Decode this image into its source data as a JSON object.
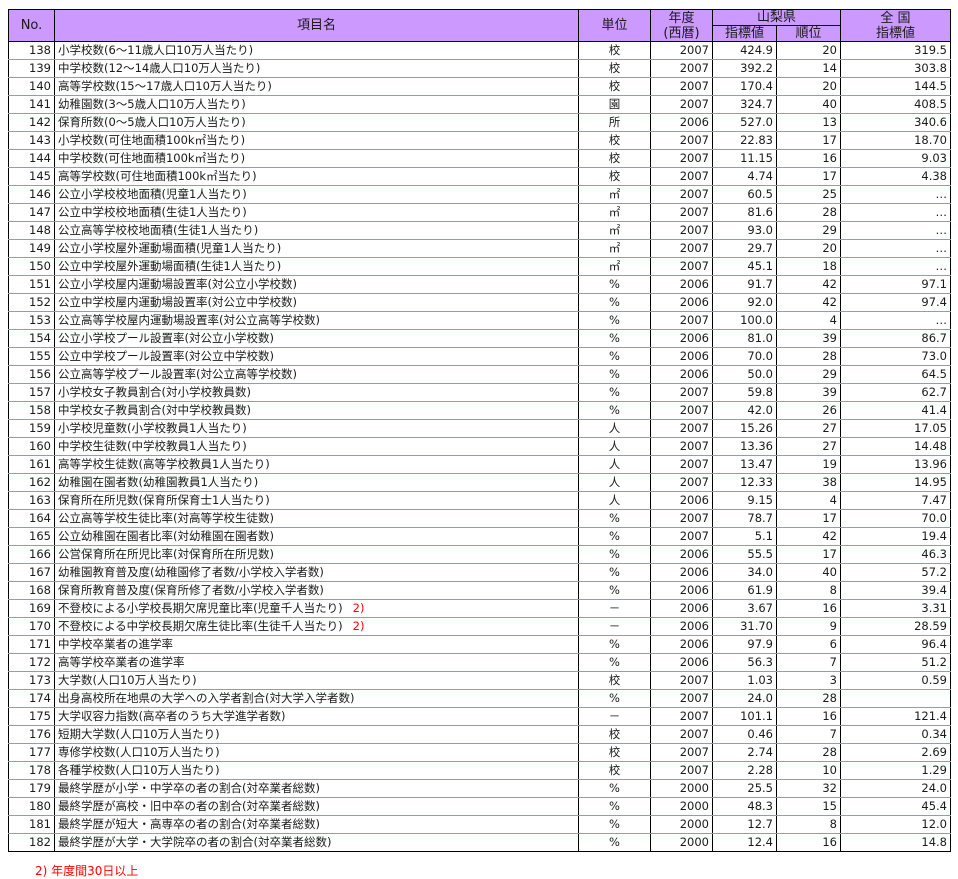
{
  "header": {
    "no": "No.",
    "name": "項目名",
    "unit": "単位",
    "year_top": "年度",
    "year_bottom": "(西暦)",
    "pref": "山梨県",
    "indicator": "指標値",
    "rank": "順位",
    "national_top": "全 国",
    "national_bottom": "指標値"
  },
  "rows": [
    {
      "no": "138",
      "name": "小学校数(6～11歳人口10万人当たり)",
      "unit": "校",
      "year": "2007",
      "val": "424.9",
      "rank": "20",
      "nat": "319.5",
      "note": ""
    },
    {
      "no": "139",
      "name": "中学校数(12～14歳人口10万人当たり)",
      "unit": "校",
      "year": "2007",
      "val": "392.2",
      "rank": "14",
      "nat": "303.8",
      "note": ""
    },
    {
      "no": "140",
      "name": "高等学校数(15～17歳人口10万人当たり)",
      "unit": "校",
      "year": "2007",
      "val": "170.4",
      "rank": "20",
      "nat": "144.5",
      "note": ""
    },
    {
      "no": "141",
      "name": "幼稚園数(3～5歳人口10万人当たり)",
      "unit": "園",
      "year": "2007",
      "val": "324.7",
      "rank": "40",
      "nat": "408.5",
      "note": ""
    },
    {
      "no": "142",
      "name": "保育所数(0～5歳人口10万人当たり)",
      "unit": "所",
      "year": "2006",
      "val": "527.0",
      "rank": "13",
      "nat": "340.6",
      "note": ""
    },
    {
      "no": "143",
      "name": "小学校数(可住地面積100k㎡当たり)",
      "unit": "校",
      "year": "2007",
      "val": "22.83",
      "rank": "17",
      "nat": "18.70",
      "note": ""
    },
    {
      "no": "144",
      "name": "中学校数(可住地面積100k㎡当たり)",
      "unit": "校",
      "year": "2007",
      "val": "11.15",
      "rank": "16",
      "nat": "9.03",
      "note": ""
    },
    {
      "no": "145",
      "name": "高等学校数(可住地面積100k㎡当たり)",
      "unit": "校",
      "year": "2007",
      "val": "4.74",
      "rank": "17",
      "nat": "4.38",
      "note": ""
    },
    {
      "no": "146",
      "name": "公立小学校校地面積(児童1人当たり)",
      "unit": "㎡",
      "year": "2007",
      "val": "60.5",
      "rank": "25",
      "nat": "…",
      "note": ""
    },
    {
      "no": "147",
      "name": "公立中学校校地面積(生徒1人当たり)",
      "unit": "㎡",
      "year": "2007",
      "val": "81.6",
      "rank": "28",
      "nat": "…",
      "note": ""
    },
    {
      "no": "148",
      "name": "公立高等学校校地面積(生徒1人当たり)",
      "unit": "㎡",
      "year": "2007",
      "val": "93.0",
      "rank": "29",
      "nat": "…",
      "note": ""
    },
    {
      "no": "149",
      "name": "公立小学校屋外運動場面積(児童1人当たり)",
      "unit": "㎡",
      "year": "2007",
      "val": "29.7",
      "rank": "20",
      "nat": "…",
      "note": ""
    },
    {
      "no": "150",
      "name": "公立中学校屋外運動場面積(生徒1人当たり)",
      "unit": "㎡",
      "year": "2007",
      "val": "45.1",
      "rank": "18",
      "nat": "…",
      "note": ""
    },
    {
      "no": "151",
      "name": "公立小学校屋内運動場設置率(対公立小学校数)",
      "unit": "%",
      "year": "2006",
      "val": "91.7",
      "rank": "42",
      "nat": "97.1",
      "note": ""
    },
    {
      "no": "152",
      "name": "公立中学校屋内運動場設置率(対公立中学校数)",
      "unit": "%",
      "year": "2006",
      "val": "92.0",
      "rank": "42",
      "nat": "97.4",
      "note": ""
    },
    {
      "no": "153",
      "name": "公立高等学校屋内運動場設置率(対公立高等学校数)",
      "unit": "%",
      "year": "2007",
      "val": "100.0",
      "rank": "4",
      "nat": "…",
      "note": ""
    },
    {
      "no": "154",
      "name": "公立小学校プール設置率(対公立小学校数)",
      "unit": "%",
      "year": "2006",
      "val": "81.0",
      "rank": "39",
      "nat": "86.7",
      "note": ""
    },
    {
      "no": "155",
      "name": "公立中学校プール設置率(対公立中学校数)",
      "unit": "%",
      "year": "2006",
      "val": "70.0",
      "rank": "28",
      "nat": "73.0",
      "note": ""
    },
    {
      "no": "156",
      "name": "公立高等学校プール設置率(対公立高等学校数)",
      "unit": "%",
      "year": "2006",
      "val": "50.0",
      "rank": "29",
      "nat": "64.5",
      "note": ""
    },
    {
      "no": "157",
      "name": "小学校女子教員割合(対小学校教員数)",
      "unit": "%",
      "year": "2007",
      "val": "59.8",
      "rank": "39",
      "nat": "62.7",
      "note": ""
    },
    {
      "no": "158",
      "name": "中学校女子教員割合(対中学校教員数)",
      "unit": "%",
      "year": "2007",
      "val": "42.0",
      "rank": "26",
      "nat": "41.4",
      "note": ""
    },
    {
      "no": "159",
      "name": "小学校児童数(小学校教員1人当たり)",
      "unit": "人",
      "year": "2007",
      "val": "15.26",
      "rank": "27",
      "nat": "17.05",
      "note": ""
    },
    {
      "no": "160",
      "name": "中学校生徒数(中学校教員1人当たり)",
      "unit": "人",
      "year": "2007",
      "val": "13.36",
      "rank": "27",
      "nat": "14.48",
      "note": ""
    },
    {
      "no": "161",
      "name": "高等学校生徒数(高等学校教員1人当たり)",
      "unit": "人",
      "year": "2007",
      "val": "13.47",
      "rank": "19",
      "nat": "13.96",
      "note": ""
    },
    {
      "no": "162",
      "name": "幼稚園在園者数(幼稚園教員1人当たり)",
      "unit": "人",
      "year": "2007",
      "val": "12.33",
      "rank": "38",
      "nat": "14.95",
      "note": ""
    },
    {
      "no": "163",
      "name": "保育所在所児数(保育所保育士1人当たり)",
      "unit": "人",
      "year": "2006",
      "val": "9.15",
      "rank": "4",
      "nat": "7.47",
      "note": ""
    },
    {
      "no": "164",
      "name": "公立高等学校生徒比率(対高等学校生徒数)",
      "unit": "%",
      "year": "2007",
      "val": "78.7",
      "rank": "17",
      "nat": "70.0",
      "note": ""
    },
    {
      "no": "165",
      "name": "公立幼稚園在園者比率(対幼稚園在園者数)",
      "unit": "%",
      "year": "2007",
      "val": "5.1",
      "rank": "42",
      "nat": "19.4",
      "note": ""
    },
    {
      "no": "166",
      "name": "公営保育所在所児比率(対保育所在所児数)",
      "unit": "%",
      "year": "2006",
      "val": "55.5",
      "rank": "17",
      "nat": "46.3",
      "note": ""
    },
    {
      "no": "167",
      "name": "幼稚園教育普及度(幼稚園修了者数/小学校入学者数)",
      "unit": "%",
      "year": "2006",
      "val": "34.0",
      "rank": "40",
      "nat": "57.2",
      "note": ""
    },
    {
      "no": "168",
      "name": "保育所教育普及度(保育所修了者数/小学校入学者数)",
      "unit": "%",
      "year": "2006",
      "val": "61.9",
      "rank": "8",
      "nat": "39.4",
      "note": ""
    },
    {
      "no": "169",
      "name": "不登校による小学校長期欠席児童比率(児童千人当たり)",
      "unit": "－",
      "year": "2006",
      "val": "3.67",
      "rank": "16",
      "nat": "3.31",
      "note": "2)"
    },
    {
      "no": "170",
      "name": "不登校による中学校長期欠席生徒比率(生徒千人当たり)",
      "unit": "－",
      "year": "2006",
      "val": "31.70",
      "rank": "9",
      "nat": "28.59",
      "note": "2)"
    },
    {
      "no": "171",
      "name": "中学校卒業者の進学率",
      "unit": "%",
      "year": "2006",
      "val": "97.9",
      "rank": "6",
      "nat": "96.4",
      "note": ""
    },
    {
      "no": "172",
      "name": "高等学校卒業者の進学率",
      "unit": "%",
      "year": "2006",
      "val": "56.3",
      "rank": "7",
      "nat": "51.2",
      "note": ""
    },
    {
      "no": "173",
      "name": "大学数(人口10万人当たり)",
      "unit": "校",
      "year": "2007",
      "val": "1.03",
      "rank": "3",
      "nat": "0.59",
      "note": ""
    },
    {
      "no": "174",
      "name": "出身高校所在地県の大学への入学者割合(対大学入学者数)",
      "unit": "%",
      "year": "2007",
      "val": "24.0",
      "rank": "28",
      "nat": "",
      "note": ""
    },
    {
      "no": "175",
      "name": "大学収容力指数(高卒者のうち大学進学者数)",
      "unit": "－",
      "year": "2007",
      "val": "101.1",
      "rank": "16",
      "nat": "121.4",
      "note": ""
    },
    {
      "no": "176",
      "name": "短期大学数(人口10万人当たり)",
      "unit": "校",
      "year": "2007",
      "val": "0.46",
      "rank": "7",
      "nat": "0.34",
      "note": ""
    },
    {
      "no": "177",
      "name": "専修学校数(人口10万人当たり)",
      "unit": "校",
      "year": "2007",
      "val": "2.74",
      "rank": "28",
      "nat": "2.69",
      "note": ""
    },
    {
      "no": "178",
      "name": "各種学校数(人口10万人当たり)",
      "unit": "校",
      "year": "2007",
      "val": "2.28",
      "rank": "10",
      "nat": "1.29",
      "note": ""
    },
    {
      "no": "179",
      "name": "最終学歴が小学・中学卒の者の割合(対卒業者総数)",
      "unit": "%",
      "year": "2000",
      "val": "25.5",
      "rank": "32",
      "nat": "24.0",
      "note": ""
    },
    {
      "no": "180",
      "name": "最終学歴が高校・旧中卒の者の割合(対卒業者総数)",
      "unit": "%",
      "year": "2000",
      "val": "48.3",
      "rank": "15",
      "nat": "45.4",
      "note": ""
    },
    {
      "no": "181",
      "name": "最終学歴が短大・高専卒の者の割合(対卒業者総数)",
      "unit": "%",
      "year": "2000",
      "val": "12.7",
      "rank": "8",
      "nat": "12.0",
      "note": ""
    },
    {
      "no": "182",
      "name": "最終学歴が大学・大学院卒の者の割合(対卒業者総数)",
      "unit": "%",
      "year": "2000",
      "val": "12.4",
      "rank": "16",
      "nat": "14.8",
      "note": ""
    }
  ],
  "footnote": "2) 年度間30日以上"
}
